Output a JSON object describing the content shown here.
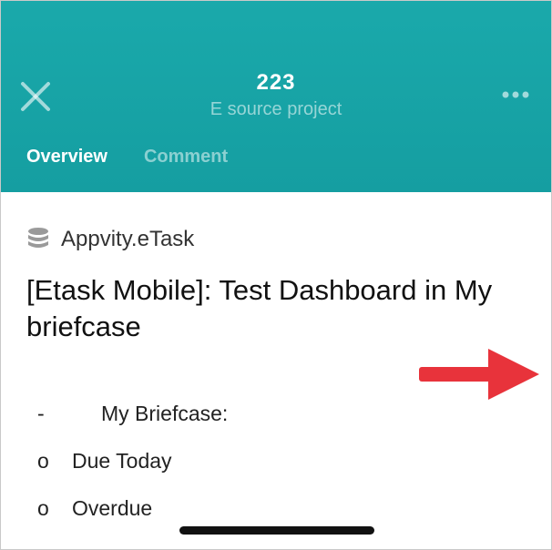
{
  "header": {
    "title": "223",
    "subtitle": "E source project",
    "close_icon": "close-icon",
    "more_icon": "more-horizontal-icon",
    "background_color": "#17a3a6"
  },
  "tabs": [
    {
      "label": "Overview",
      "active": true
    },
    {
      "label": "Comment",
      "active": false
    }
  ],
  "content": {
    "source_icon": "database-icon",
    "source_label": "Appvity.eTask",
    "title": "[Etask Mobile]: Test Dashboard in My briefcase",
    "list": [
      {
        "marker": "-",
        "text": "My Briefcase:"
      },
      {
        "marker": "o",
        "text": "Due Today"
      },
      {
        "marker": "o",
        "text": "Overdue"
      }
    ]
  },
  "annotation": {
    "arrow_icon": "arrow-right-icon",
    "arrow_color": "#e8333b"
  }
}
